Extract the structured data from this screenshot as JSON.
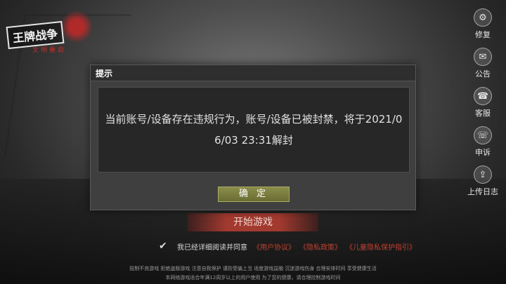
{
  "logo": {
    "title": "王牌战争",
    "subtitle": "文明重启"
  },
  "sidebar": {
    "items": [
      {
        "label": "修复",
        "icon": "gear-icon",
        "glyph": "⚙"
      },
      {
        "label": "公告",
        "icon": "notice-icon",
        "glyph": "✉"
      },
      {
        "label": "客服",
        "icon": "headset-icon",
        "glyph": "☎"
      },
      {
        "label": "申诉",
        "icon": "appeal-icon",
        "glyph": "☏"
      },
      {
        "label": "上传日志",
        "icon": "upload-icon",
        "glyph": "⇪"
      }
    ]
  },
  "dialog": {
    "title": "提示",
    "message": "当前账号/设备存在违规行为，账号/设备已被封禁，将于2021/06/03 23:31解封",
    "confirm_label": "确 定"
  },
  "start_button": "开始游戏",
  "agreement": {
    "prefix": "我已经详细阅读并同意",
    "links": [
      "《用户协议》",
      "《隐私政策》",
      "《儿童隐私保护指引》"
    ]
  },
  "footer": {
    "line1": "抵制不良游戏  拒绝盗版游戏  注意自我保护  谨防受骗上当  适度游戏益脑  沉迷游戏伤身  合理安排时间  享受健康生活",
    "line2": "本网络游戏适合年满12周岁以上的用户使用    为了您的健康，请合理控制游戏时间"
  },
  "colors": {
    "accent_red": "#c2402e",
    "confirm_olive": "#7a7d3f"
  }
}
